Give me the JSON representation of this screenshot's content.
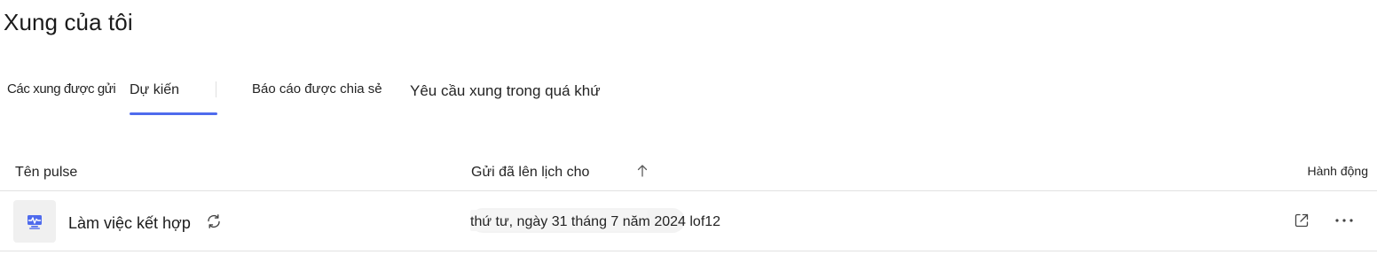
{
  "page": {
    "title": "Xung của tôi"
  },
  "tabs": [
    {
      "label": "Các xung được gửi"
    },
    {
      "label": "Dự kiến"
    },
    {
      "label": "Báo cáo được chia sẻ"
    },
    {
      "label": "Yêu cầu xung trong quá khứ"
    }
  ],
  "active_tab": "Dự kiến",
  "table": {
    "headers": {
      "name": "Tên pulse",
      "scheduled": "Gửi đã lên lịch cho",
      "actions": "Hành động"
    },
    "sort": {
      "column": "scheduled",
      "direction": "ascending"
    },
    "rows": [
      {
        "name": "Làm việc kết hợp",
        "recurring": true,
        "scheduled": "thứ tư, ngày 31 tháng 7 năm 2024 lof12",
        "icon": "pulse-survey-icon"
      }
    ]
  },
  "colors": {
    "accent": "#4f6bed",
    "icon_tile": "#f0f0f0"
  }
}
